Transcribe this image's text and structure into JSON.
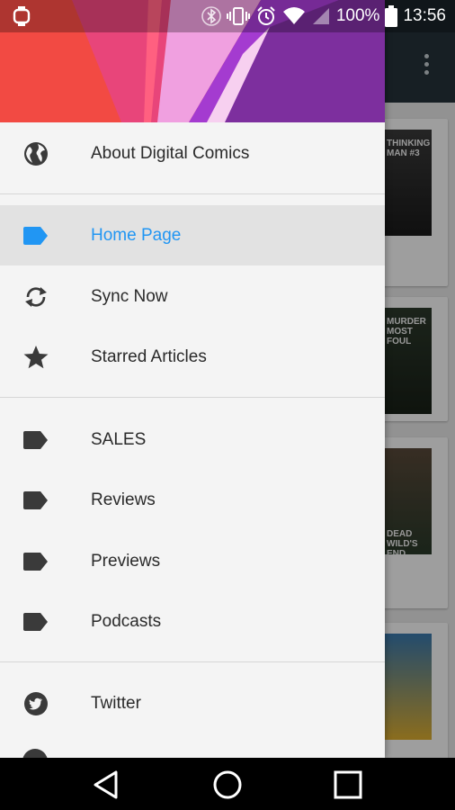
{
  "status_bar": {
    "battery_text": "100%",
    "time": "13:56",
    "icons": [
      "watch-icon",
      "bluetooth-icon",
      "vibrate-icon",
      "alarm-icon",
      "wifi-icon",
      "signal-icon",
      "battery-icon"
    ]
  },
  "drawer": {
    "header_colors": [
      "#f24a43",
      "#e8457a",
      "#f0a0e0",
      "#a43bd0",
      "#7d2f9e"
    ],
    "about": {
      "label": "About Digital Comics",
      "icon": "globe-icon"
    },
    "main_items": [
      {
        "label": "Home Page",
        "icon": "label-icon",
        "selected": true
      },
      {
        "label": "Sync Now",
        "icon": "sync-icon",
        "selected": false
      },
      {
        "label": "Starred Articles",
        "icon": "star-icon",
        "selected": false
      }
    ],
    "categories": [
      {
        "label": "SALES",
        "icon": "label-icon"
      },
      {
        "label": "Reviews",
        "icon": "label-icon"
      },
      {
        "label": "Previews",
        "icon": "label-icon"
      },
      {
        "label": "Podcasts",
        "icon": "label-icon"
      }
    ],
    "social": [
      {
        "label": "Twitter",
        "icon": "twitter-icon"
      }
    ]
  },
  "background_app": {
    "toolbar_color": "#26323a",
    "comic_covers": [
      {
        "text": "THINKING MAN #3"
      },
      {
        "text": "MURDER MOST FOUL"
      },
      {
        "text": "DEAD WILD'S END"
      },
      {
        "text": ""
      }
    ]
  },
  "colors": {
    "accent": "#2196f3",
    "icon": "#3a3a3a"
  },
  "nav_bar": {
    "buttons": [
      "back-icon",
      "home-icon",
      "recents-icon"
    ]
  }
}
